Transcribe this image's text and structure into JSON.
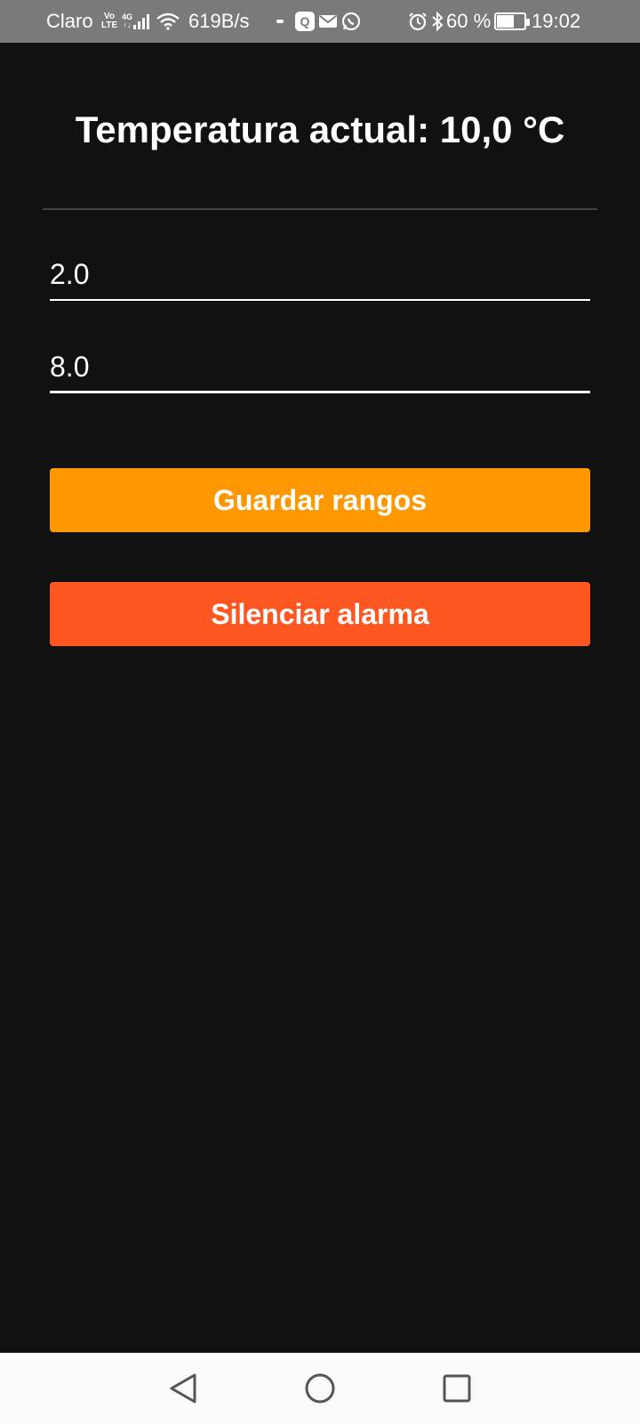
{
  "status_bar": {
    "carrier": "Claro",
    "volte_top": "Vo",
    "volte_bottom": "LTE",
    "network_top": "4G",
    "network_bottom": "↑↓",
    "data_speed": "619B/s",
    "notif_app": "Q",
    "battery_percent": "60 %",
    "battery_level": 0.6,
    "time": "19:02",
    "icons": [
      "signal-icon",
      "wifi-icon",
      "dot-icon",
      "app-q-icon",
      "mail-icon",
      "whatsapp-icon",
      "alarm-icon",
      "bluetooth-icon",
      "battery-icon"
    ]
  },
  "main": {
    "title": "Temperatura actual: 10,0 °C",
    "min_value": "2.0",
    "max_value": "8.0",
    "save_button_label": "Guardar rangos",
    "silence_button_label": "Silenciar alarma"
  },
  "colors": {
    "background": "#111111",
    "save_button": "#ff9800",
    "silence_button": "#ff5722",
    "status_bar": "#7a7a7a",
    "nav_bar": "#fafafa"
  },
  "nav_bar": {
    "icons": [
      "back-icon",
      "home-icon",
      "recents-icon"
    ]
  }
}
